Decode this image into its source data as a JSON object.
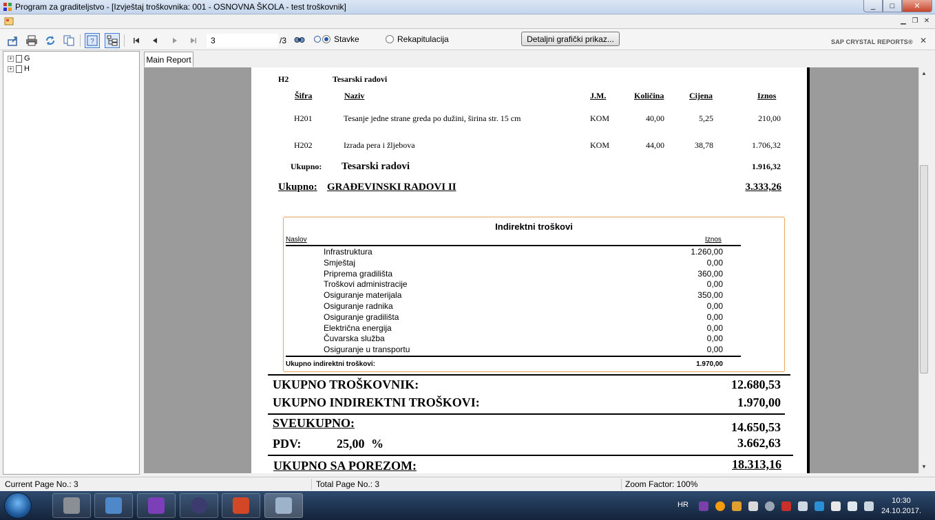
{
  "window": {
    "title": "Program za graditeljstvo - [Izvještaj troškovnika: 001 - OSNOVNA ŠKOLA - test troškovnik]",
    "min": "_",
    "max": "□",
    "close": "✕"
  },
  "toolbar": {
    "page_input": "3",
    "page_total": "/3",
    "radio_items": "Stavke",
    "radio_recap": "Rekapitulacija",
    "graphic_button": "Detaljni grafički prikaz...",
    "brand": "SAP CRYSTAL REPORTS®"
  },
  "tree": {
    "items": [
      "G",
      "H"
    ]
  },
  "tabs": {
    "main": "Main Report"
  },
  "report": {
    "section_code": "H2",
    "section_title": "Tesarski radovi",
    "headers": {
      "code": "Šifra",
      "name": "Naziv",
      "unit": "J.M.",
      "qty": "Količina",
      "price": "Cijena",
      "amount": "Iznos"
    },
    "rows": [
      {
        "code": "H201",
        "name": "Tesanje jedne strane greda po dužini, širina str. 15 cm",
        "unit": "KOM",
        "qty": "40,00",
        "price": "5,25",
        "amount": "210,00"
      },
      {
        "code": "H202",
        "name": "Izrada pera i žljebova",
        "unit": "KOM",
        "qty": "44,00",
        "price": "38,78",
        "amount": "1.706,32"
      }
    ],
    "subtotal_label": "Ukupno:",
    "subtotal_name": "Tesarski radovi",
    "subtotal_value": "1.916,32",
    "group_label": "Ukupno:",
    "group_name": "GRAĐEVINSKI RADOVI II",
    "group_value": "3.333,26",
    "indirect": {
      "title": "Indirektni troškovi",
      "col_title": "Naslov",
      "col_amount": "Iznos",
      "items": [
        {
          "name": "Infrastruktura",
          "value": "1.260,00"
        },
        {
          "name": "Smještaj",
          "value": "0,00"
        },
        {
          "name": "Priprema gradilišta",
          "value": "360,00"
        },
        {
          "name": "Troškovi administracije",
          "value": "0,00"
        },
        {
          "name": "Osiguranje materijala",
          "value": "350,00"
        },
        {
          "name": "Osiguranje radnika",
          "value": "0,00"
        },
        {
          "name": "Osiguranje gradilišta",
          "value": "0,00"
        },
        {
          "name": "Električna energija",
          "value": "0,00"
        },
        {
          "name": "Čuvarska služba",
          "value": "0,00"
        },
        {
          "name": "Osiguranje u transportu",
          "value": "0,00"
        }
      ],
      "total_label": "Ukupno indirektni troškovi:",
      "total_value": "1.970,00"
    },
    "totals": {
      "cost_label": "UKUPNO TROŠKOVNIK:",
      "cost_value": "12.680,53",
      "indirect_label": "UKUPNO INDIREKTNI TROŠKOVI:",
      "indirect_value": "1.970,00",
      "grand_label": "SVEUKUPNO:",
      "grand_value": "14.650,53",
      "vat_label": "PDV:",
      "vat_rate": "25,00",
      "vat_pct": "%",
      "vat_value": "3.662,63",
      "final_label": "UKUPNO SA POREZOM:",
      "final_value": "18.313,16"
    }
  },
  "status": {
    "current_page": "Current Page No.: 3",
    "total_page": "Total Page No.: 3",
    "zoom": "Zoom Factor: 100%"
  },
  "taskbar": {
    "language": "HR",
    "time": "10:30",
    "date": "24.10.2017."
  }
}
